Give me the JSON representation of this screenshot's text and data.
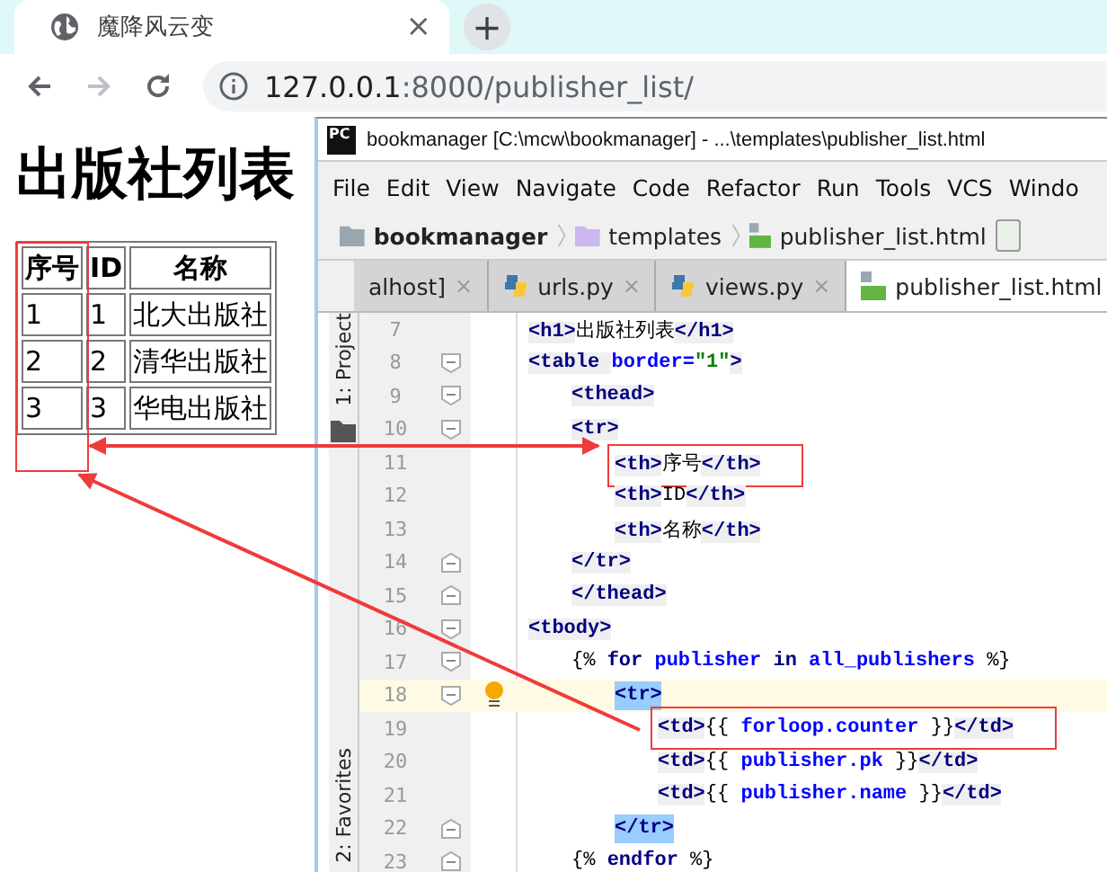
{
  "browser": {
    "tab": {
      "title": "魔降风云变",
      "close": "×"
    },
    "new_tab": "+",
    "url_host": "127.0.0.1",
    "url_rest": ":8000/publisher_list/"
  },
  "page": {
    "heading": "出版社列表",
    "columns": [
      "序号",
      "ID",
      "名称"
    ],
    "rows": [
      [
        "1",
        "1",
        "北大出版社"
      ],
      [
        "2",
        "2",
        "清华出版社"
      ],
      [
        "3",
        "3",
        "华电出版社"
      ]
    ]
  },
  "ide": {
    "app_icon": "PC",
    "title": "bookmanager [C:\\mcw\\bookmanager] - ...\\templates\\publisher_list.html",
    "menu": [
      "File",
      "Edit",
      "View",
      "Navigate",
      "Code",
      "Refactor",
      "Run",
      "Tools",
      "VCS",
      "Windo"
    ],
    "breadcrumb": [
      {
        "kind": "project",
        "label": "bookmanager"
      },
      {
        "kind": "folder",
        "label": "templates"
      },
      {
        "kind": "html",
        "label": "publisher_list.html"
      }
    ],
    "tabs": [
      {
        "label": "alhost]",
        "kind": "plain",
        "selected": false
      },
      {
        "label": "urls.py",
        "kind": "python",
        "selected": false
      },
      {
        "label": "views.py",
        "kind": "python",
        "selected": false
      },
      {
        "label": "publisher_list.html",
        "kind": "html",
        "selected": true
      }
    ],
    "tab_close": "×",
    "side_tools": [
      "1: Project",
      "2: Favorites"
    ],
    "lines": [
      {
        "num": "7",
        "current": false,
        "boxed": false,
        "matched": false,
        "tokens": [
          {
            "kind": "tag",
            "text": "<h1>"
          },
          {
            "kind": "text",
            "text": "出版社列表"
          },
          {
            "kind": "tag",
            "text": "</h1>"
          }
        ]
      },
      {
        "num": "8",
        "kind": "open",
        "current": false,
        "boxed": false,
        "matched": false,
        "tokens": [
          {
            "kind": "tag",
            "text": "<table "
          },
          {
            "kind": "attr",
            "text": " border="
          },
          {
            "kind": "value",
            "text": "\"1\""
          },
          {
            "kind": "tag",
            "text": ">"
          }
        ],
        "children": [
          {
            "num": "9",
            "kind": "open",
            "current": false,
            "boxed": false,
            "matched": false,
            "tokens": [
              {
                "kind": "tag",
                "text": "<thead>"
              }
            ]
          },
          {
            "num": "10",
            "kind": "open",
            "current": false,
            "boxed": false,
            "matched": false,
            "tokens": [
              {
                "kind": "tag",
                "text": "<tr>"
              }
            ],
            "children": [
              {
                "num": "11",
                "current": false,
                "boxed": true,
                "matched": false,
                "tokens": [
                  {
                    "kind": "tag",
                    "text": "<th>"
                  },
                  {
                    "kind": "text",
                    "text": "序号"
                  },
                  {
                    "kind": "tag",
                    "text": "</th>"
                  }
                ]
              },
              {
                "num": "12",
                "current": false,
                "boxed": false,
                "matched": false,
                "tokens": [
                  {
                    "kind": "tag",
                    "text": "<th>"
                  },
                  {
                    "kind": "text",
                    "text": "ID"
                  },
                  {
                    "kind": "tag",
                    "text": "</th>"
                  }
                ]
              },
              {
                "num": "13",
                "current": false,
                "boxed": false,
                "matched": false,
                "tokens": [
                  {
                    "kind": "tag",
                    "text": "<th>"
                  },
                  {
                    "kind": "text",
                    "text": "名称"
                  },
                  {
                    "kind": "tag",
                    "text": "</th>"
                  }
                ]
              }
            ]
          },
          {
            "num": "14",
            "kind": "close",
            "current": false,
            "boxed": false,
            "matched": false,
            "tokens": [
              {
                "kind": "tag",
                "text": "</tr>"
              }
            ]
          },
          {
            "num": "15",
            "kind": "close",
            "current": false,
            "boxed": false,
            "matched": false,
            "tokens": [
              {
                "kind": "tag",
                "text": "</thead>"
              }
            ]
          }
        ]
      },
      {
        "num": "16",
        "kind": "open",
        "current": false,
        "boxed": false,
        "matched": false,
        "tokens": [
          {
            "kind": "tag",
            "text": "<tbody>"
          }
        ],
        "children": [
          {
            "num": "17",
            "kind": "open",
            "current": false,
            "boxed": false,
            "matched": false,
            "tokens": [
              {
                "kind": "text",
                "text": "{% "
              },
              {
                "kind": "keyword",
                "text": "for"
              },
              {
                "kind": "var",
                "text": " publisher "
              },
              {
                "kind": "keyword",
                "text": "in"
              },
              {
                "kind": "var",
                "text": " all_publishers"
              },
              {
                "kind": "text",
                "text": " %}"
              }
            ],
            "children": [
              {
                "num": "18",
                "kind": "open",
                "current": true,
                "boxed": false,
                "matched": true,
                "tokens": [
                  {
                    "kind": "tag",
                    "text": "<tr>"
                  }
                ],
                "children": [
                  {
                    "num": "19",
                    "current": false,
                    "boxed": true,
                    "matched": false,
                    "tokens": [
                      {
                        "kind": "tag",
                        "text": "<td>"
                      },
                      {
                        "kind": "text",
                        "text": "{{ "
                      },
                      {
                        "kind": "var",
                        "text": "forloop.counter"
                      },
                      {
                        "kind": "text",
                        "text": " }}"
                      },
                      {
                        "kind": "tag",
                        "text": "</td>"
                      }
                    ]
                  },
                  {
                    "num": "20",
                    "current": false,
                    "boxed": false,
                    "matched": false,
                    "tokens": [
                      {
                        "kind": "tag",
                        "text": "<td>"
                      },
                      {
                        "kind": "text",
                        "text": "{{ "
                      },
                      {
                        "kind": "var",
                        "text": "publisher.pk"
                      },
                      {
                        "kind": "text",
                        "text": " }}"
                      },
                      {
                        "kind": "tag",
                        "text": "</td>"
                      }
                    ]
                  },
                  {
                    "num": "21",
                    "current": false,
                    "boxed": false,
                    "matched": false,
                    "tokens": [
                      {
                        "kind": "tag",
                        "text": "<td>"
                      },
                      {
                        "kind": "text",
                        "text": "{{ "
                      },
                      {
                        "kind": "var",
                        "text": "publisher.name"
                      },
                      {
                        "kind": "text",
                        "text": " }}"
                      },
                      {
                        "kind": "tag",
                        "text": "</td>"
                      }
                    ]
                  }
                ]
              },
              {
                "num": "22",
                "kind": "close",
                "current": false,
                "boxed": false,
                "matched": true,
                "tokens": [
                  {
                    "kind": "tag",
                    "text": "</tr>"
                  }
                ]
              }
            ]
          },
          {
            "num": "23",
            "kind": "close",
            "current": false,
            "boxed": false,
            "matched": false,
            "tokens": [
              {
                "kind": "text",
                "text": "{% "
              },
              {
                "kind": "keyword",
                "text": "endfor"
              },
              {
                "kind": "text",
                "text": " %}"
              }
            ]
          }
        ]
      }
    ]
  }
}
